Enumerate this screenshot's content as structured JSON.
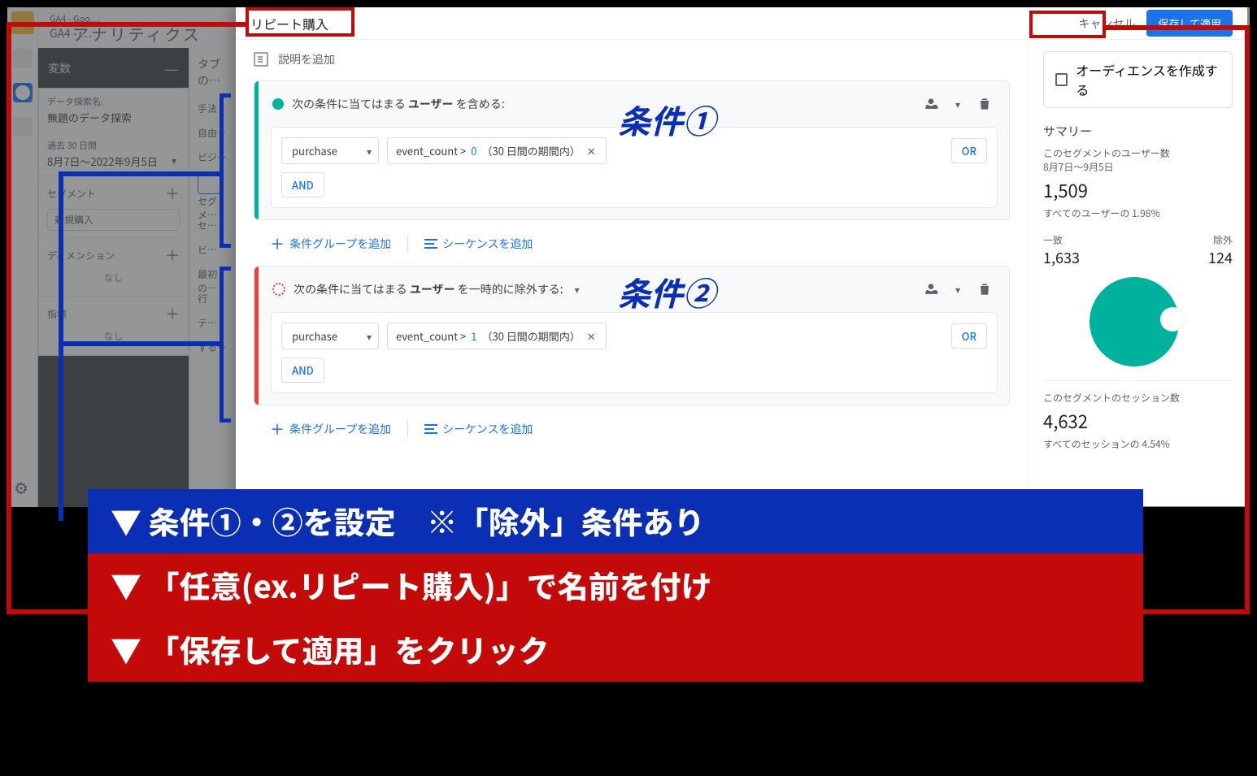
{
  "ga": {
    "product": "アナリティクス",
    "breadcrumb1": "GA4 - Goo…",
    "breadcrumb2": "GA4 - …"
  },
  "vars": {
    "panel_title": "変数",
    "name_label": "データ探索名:",
    "name_value": "無題のデータ探索",
    "date_label": "過去 30 日間",
    "date_value": "8月7日〜2022年9月5日",
    "segments_label": "セグメント",
    "segment1": "新規購入",
    "dimensions_label": "ディメンション",
    "metrics_label": "指標",
    "none": "なし"
  },
  "tabs": {
    "header": "タブの…",
    "method_label": "手法",
    "method_value": "自由…",
    "viz_label": "ビジ…",
    "seg_label": "セグメ…",
    "seg2": "セ…",
    "viz2": "ビ…",
    "last": "最初の…",
    "rows": "行",
    "disp1": "テ…",
    "disp2": "する…"
  },
  "modal": {
    "segment_name": "リピート購入",
    "cancel": "キャンセル",
    "save": "保存して適用",
    "add_description": "説明を追加",
    "include_prefix": "次の条件に当てはまる",
    "include_bold": "ユーザー",
    "include_suffix": "を含める:",
    "exclude_prefix": "次の条件に当てはまる",
    "exclude_bold": "ユーザー",
    "exclude_suffix": "を一時的に除外する:",
    "and": "AND",
    "or": "OR",
    "add_group": "条件グループを追加",
    "add_sequence": "シーケンスを追加",
    "event": "purchase",
    "param_label": "event_count > ",
    "param_val_1": "0",
    "param_val_2": "1",
    "param_suffix": "（30 日間の期間内）"
  },
  "summary": {
    "create_audience": "オーディエンスを作成する",
    "title": "サマリー",
    "users_label": "このセグメントのユーザー数",
    "users_range": "8月7日〜9月5日",
    "users_value": "1,509",
    "users_pct": "すべてのユーザーの 1.98%",
    "match_label": "一致",
    "match_value": "1,633",
    "exclude_label": "除外",
    "exclude_value": "124",
    "sessions_label": "このセグメントのセッション数",
    "sessions_value": "4,632",
    "sessions_pct": "すべてのセッションの 4.54%"
  },
  "anno": {
    "cond1": "条件①",
    "cond2": "条件②",
    "callout1": "▼ 条件①・②を設定　※「除外」条件あり",
    "callout2": "▼ 「任意(ex.リピート購入)」で名前を付け",
    "callout3": "▼ 「保存して適用」をクリック"
  }
}
